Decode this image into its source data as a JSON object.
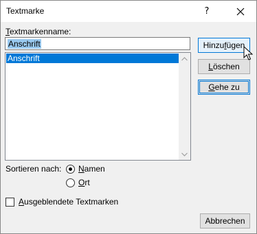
{
  "window": {
    "title": "Textmarke",
    "help_label": "?"
  },
  "bookmark_name": {
    "label_accel": "T",
    "label_rest": "extmarkenname:",
    "value": "Anschrift"
  },
  "bookmark_list": {
    "items": [
      "Anschrift"
    ],
    "selected": "Anschrift"
  },
  "sort": {
    "label": "Sortieren nach:",
    "options": [
      {
        "accel": "N",
        "rest": "amen",
        "selected": true
      },
      {
        "accel": "O",
        "rest": "rt",
        "selected": false
      }
    ]
  },
  "hidden_bookmarks": {
    "accel": "A",
    "rest": "usgeblendete Textmarken",
    "checked": false
  },
  "buttons": {
    "add": {
      "pre": "Hinzu",
      "accel": "f",
      "post": "ügen"
    },
    "delete": {
      "pre": "",
      "accel": "L",
      "post": "öschen"
    },
    "goto": {
      "pre": "",
      "accel": "G",
      "post": "ehe zu"
    },
    "cancel": "Abbrechen"
  },
  "colors": {
    "selection": "#0078d7",
    "input_selection": "#99c9ef",
    "hover_button_bg": "#e5f1fb"
  }
}
